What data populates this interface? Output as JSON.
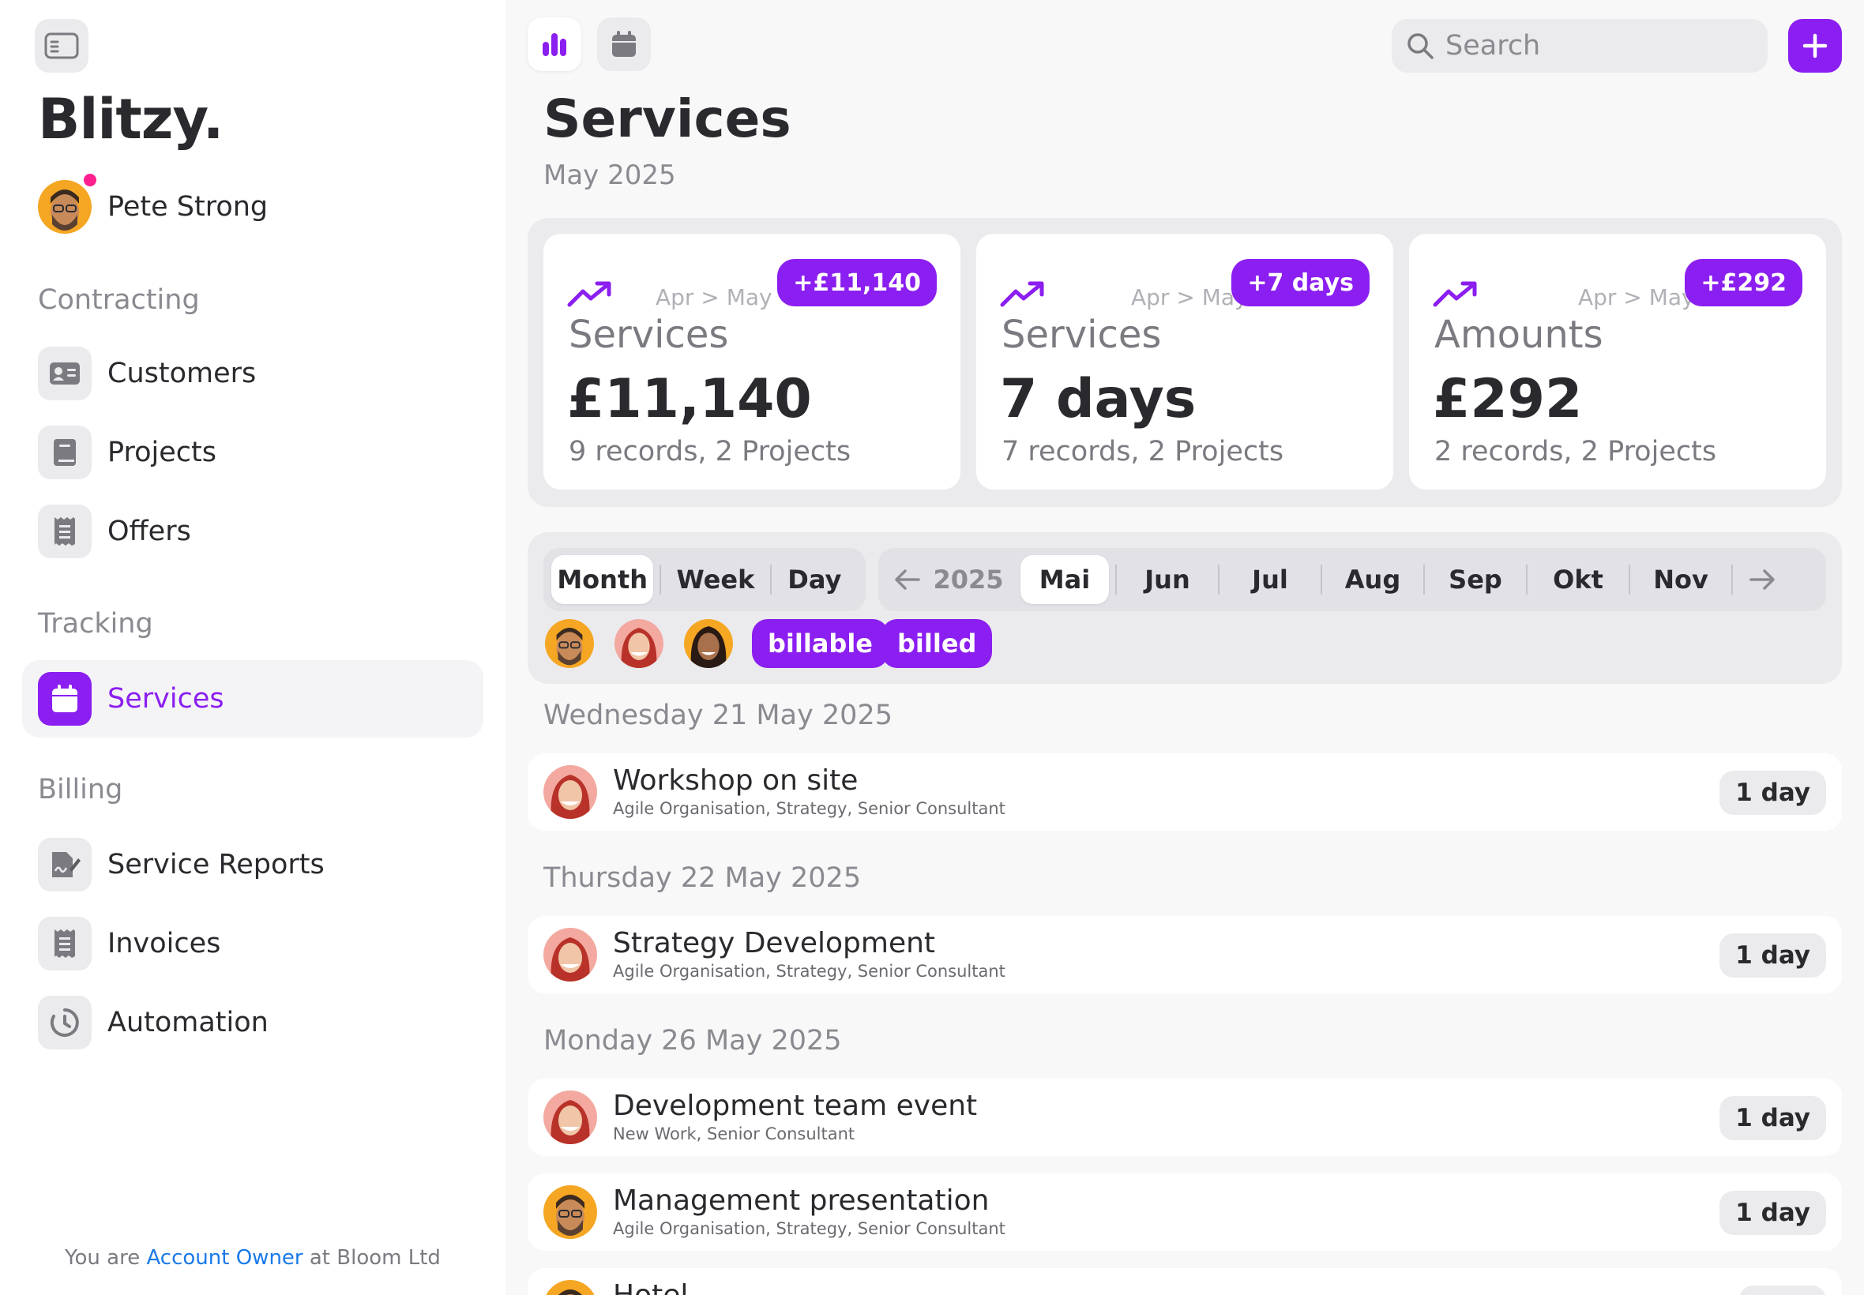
{
  "app": {
    "logo": "Blitzy.",
    "user_name": "Pete Strong"
  },
  "sidebar": {
    "sections": [
      {
        "title": "Contracting",
        "items": [
          {
            "label": "Customers",
            "icon": "id-card-icon"
          },
          {
            "label": "Projects",
            "icon": "book-icon"
          },
          {
            "label": "Offers",
            "icon": "receipt-icon"
          }
        ]
      },
      {
        "title": "Tracking",
        "items": [
          {
            "label": "Services",
            "icon": "calendar-icon",
            "active": true
          }
        ]
      },
      {
        "title": "Billing",
        "items": [
          {
            "label": "Service Reports",
            "icon": "signature-icon"
          },
          {
            "label": "Invoices",
            "icon": "receipt-icon"
          },
          {
            "label": "Automation",
            "icon": "timer-icon"
          }
        ]
      }
    ],
    "footer": {
      "prefix": "You are ",
      "role": "Account Owner",
      "suffix": " at Bloom Ltd"
    }
  },
  "toolbar": {
    "search_placeholder": "Search",
    "tabs": [
      {
        "icon": "bar-chart-icon",
        "active": true
      },
      {
        "icon": "calendar-icon",
        "active": false
      }
    ],
    "add_icon": "plus-icon"
  },
  "page": {
    "title": "Services",
    "subtitle": "May 2025"
  },
  "stats": [
    {
      "range": "Apr > May",
      "delta": "+£11,140",
      "label": "Services",
      "value": "£11,140",
      "records": "9 records, 2 Projects"
    },
    {
      "range": "Apr > May",
      "delta": "+7 days",
      "label": "Services",
      "value": "7 days",
      "records": "7 records, 2 Projects"
    },
    {
      "range": "Apr > May",
      "delta": "+£292",
      "label": "Amounts",
      "value": "£292",
      "records": "2 records, 2 Projects"
    }
  ],
  "filters": {
    "periods": [
      "Month",
      "Week",
      "Day"
    ],
    "selected_period": "Month",
    "year": "2025",
    "months": [
      "Mai",
      "Jun",
      "Jul",
      "Aug",
      "Sep",
      "Okt",
      "Nov"
    ],
    "selected_month": "Mai",
    "tags": [
      "billable",
      "billed"
    ]
  },
  "days": [
    {
      "header": "Wednesday 21 May 2025",
      "entries": [
        {
          "title": "Workshop on site",
          "sub": "Agile Organisation, Strategy, Senior Consultant",
          "duration": "1 day",
          "person": "red-hair-woman"
        }
      ]
    },
    {
      "header": "Thursday 22 May 2025",
      "entries": [
        {
          "title": "Strategy Development",
          "sub": "Agile Organisation, Strategy, Senior Consultant",
          "duration": "1 day",
          "person": "red-hair-woman"
        }
      ]
    },
    {
      "header": "Monday 26 May 2025",
      "entries": [
        {
          "title": "Development team event",
          "sub": "New Work, Senior Consultant",
          "duration": "1 day",
          "person": "red-hair-woman"
        },
        {
          "title": "Management presentation",
          "sub": "Agile Organisation, Strategy, Senior Consultant",
          "duration": "1 day",
          "person": "bearded-man"
        },
        {
          "title": "Hotel",
          "sub": "",
          "duration": "",
          "person": "bearded-man"
        }
      ]
    }
  ],
  "colors": {
    "accent": "#8b1ef0",
    "link": "#1a7ae8",
    "notification": "#ff1f8e"
  }
}
